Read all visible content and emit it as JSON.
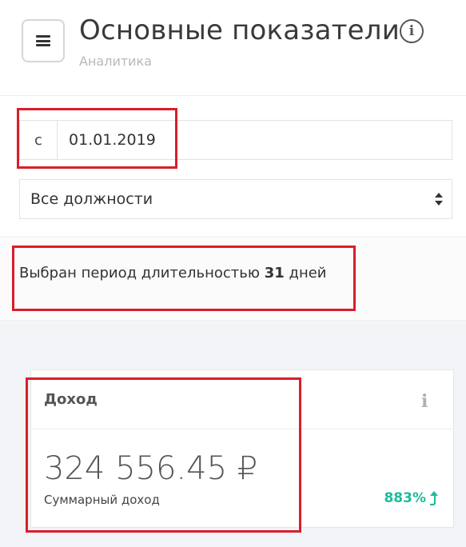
{
  "header": {
    "title": "Основные показатели",
    "subtitle": "Аналитика",
    "menu_icon": "hamburger-icon",
    "info_icon": "info-icon"
  },
  "filters": {
    "date_prefix": "с",
    "date_value": "01.01.2019",
    "position_select": {
      "selected": "Все должности"
    }
  },
  "period": {
    "text_before": "Выбран период длительностью ",
    "days": "31",
    "text_after": " дней"
  },
  "card": {
    "title": "Доход",
    "info_icon": "info-icon",
    "value": "324 556.45 ₽",
    "label": "Суммарный доход",
    "change": "883%",
    "change_icon": "arrow-up-icon",
    "change_color": "#1abc9c"
  },
  "colors": {
    "highlight": "#d91e2a",
    "page_bg": "#f3f4f7"
  }
}
